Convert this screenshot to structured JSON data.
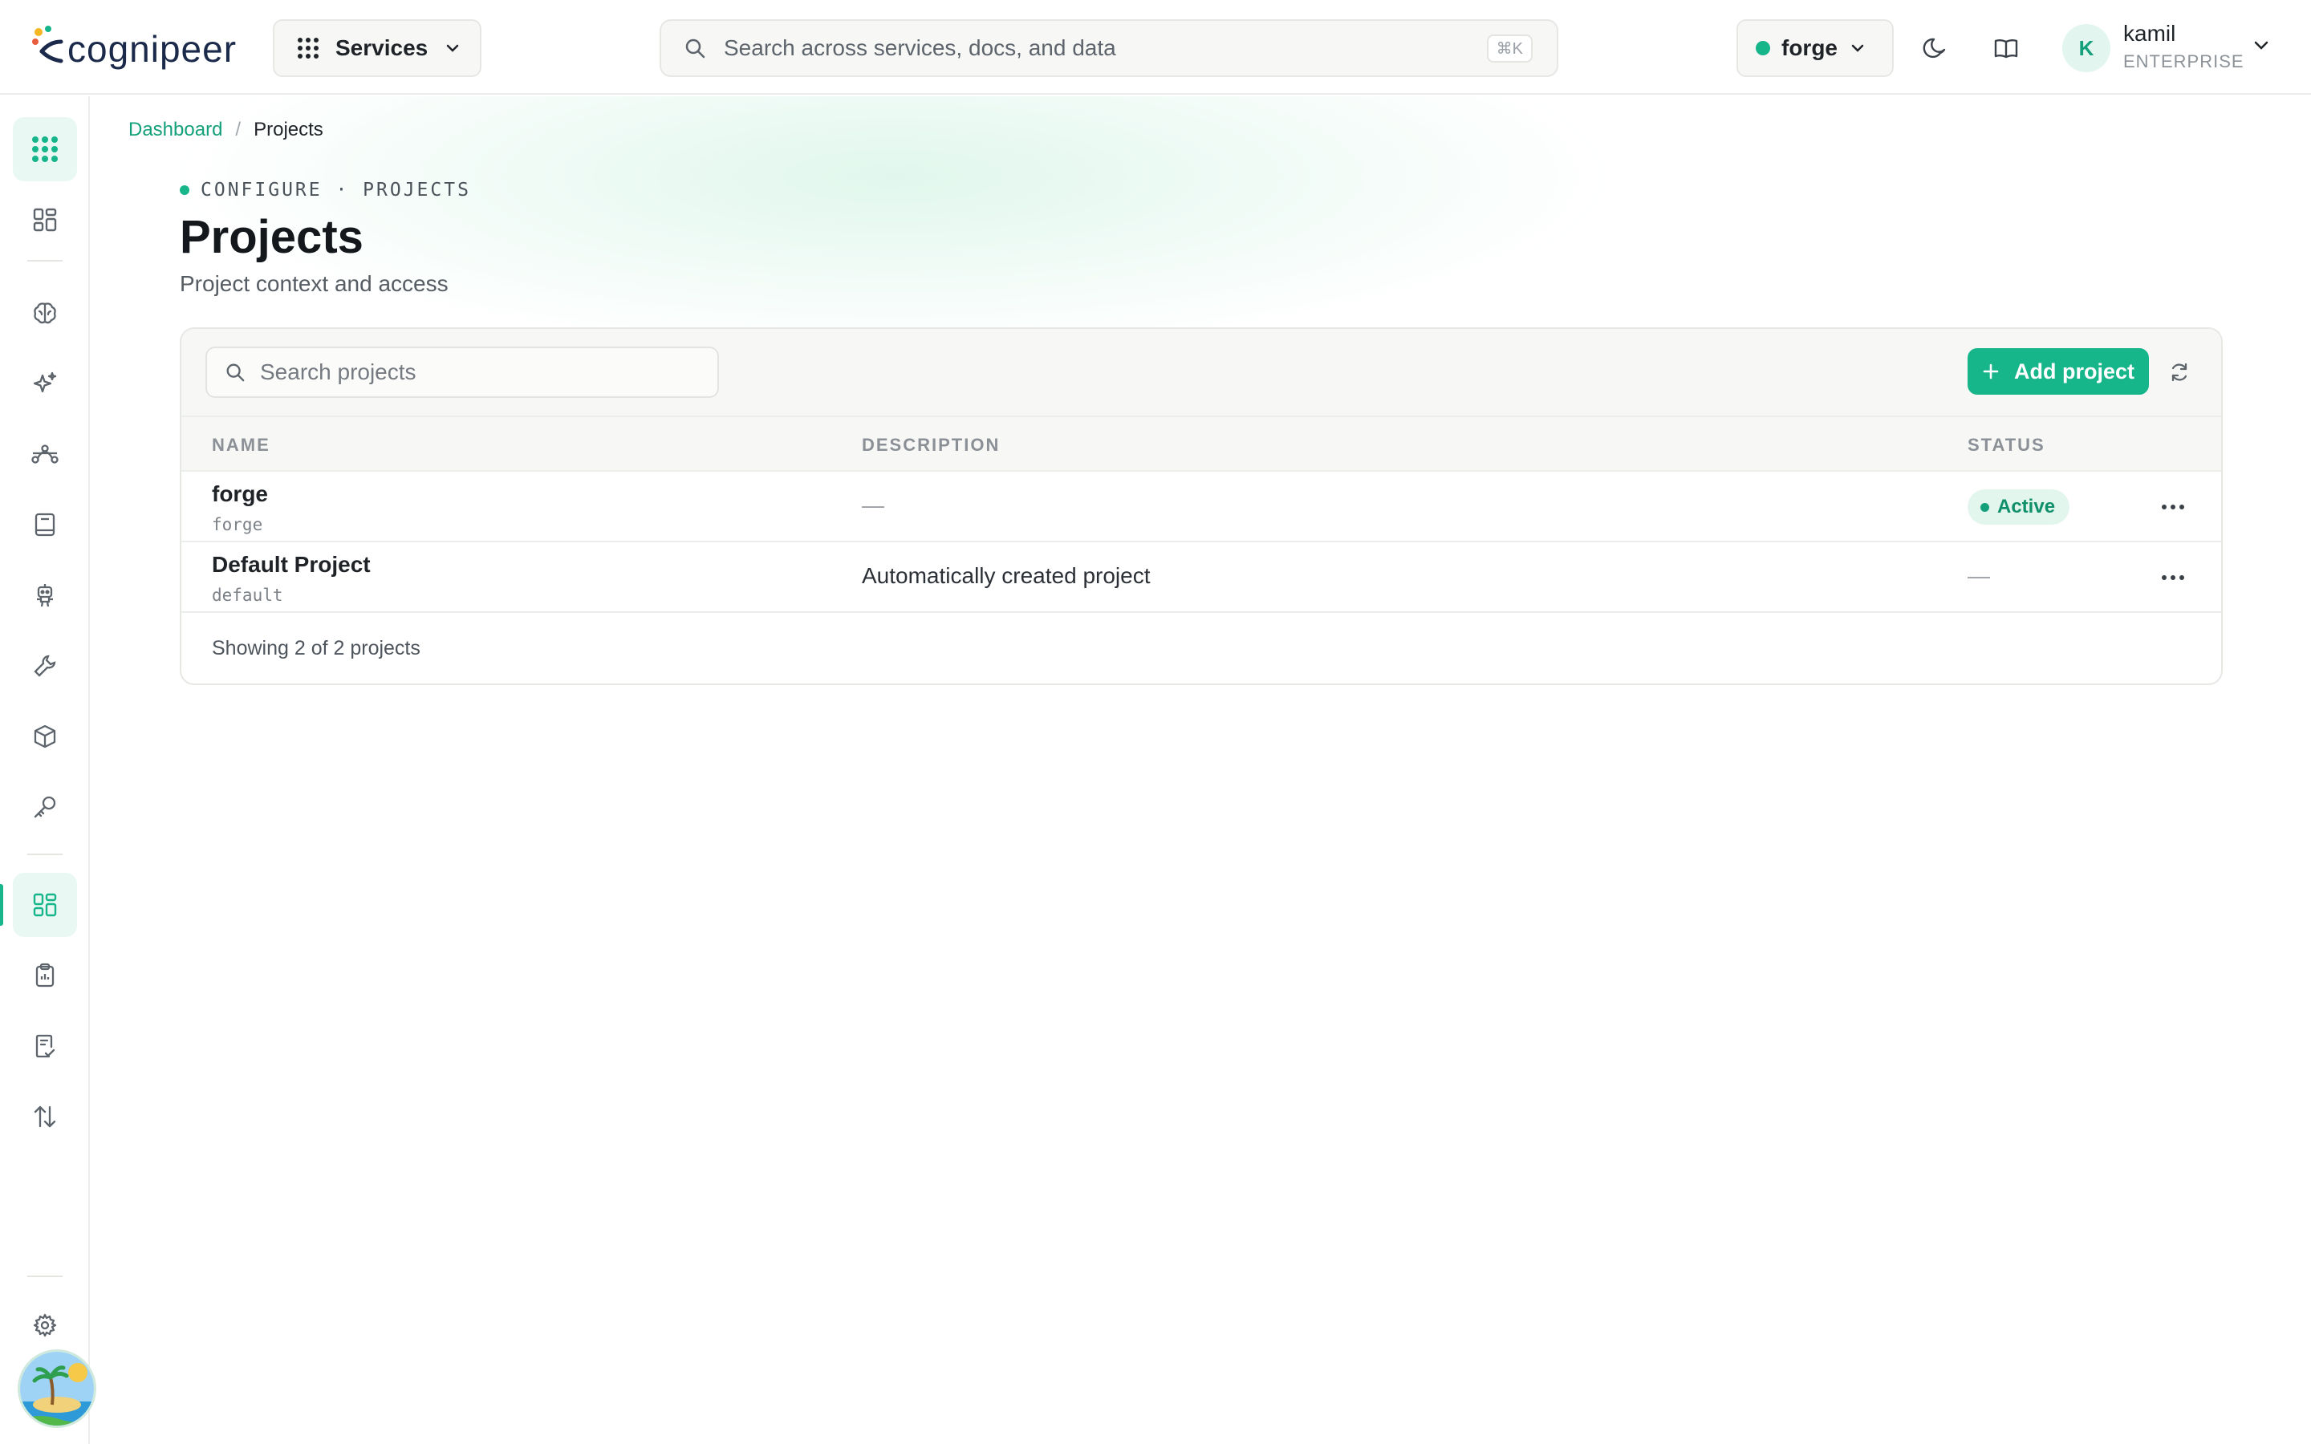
{
  "app": {
    "logo_text": "cognipeer",
    "services_label": "Services",
    "search_placeholder": "Search across services, docs, and data",
    "search_shortcut": "⌘K",
    "project_switcher": "forge",
    "user": {
      "initial": "K",
      "name": "kamil",
      "tier": "ENTERPRISE"
    }
  },
  "sidebar": {
    "icons": [
      "apps-grid-icon",
      "dashboard-icon",
      "brain-icon",
      "sparkles-icon",
      "flow-icon",
      "book-icon",
      "robot-icon",
      "tools-icon",
      "cube-icon",
      "key-icon",
      "projects-icon",
      "clipboard-icon",
      "checklist-icon",
      "transfer-icon",
      "gear-icon"
    ],
    "active": "projects-icon"
  },
  "breadcrumb": {
    "root": "Dashboard",
    "separator": "/",
    "current": "Projects"
  },
  "page": {
    "eyebrow": "CONFIGURE · PROJECTS",
    "title": "Projects",
    "subtitle": "Project context and access"
  },
  "table": {
    "search_placeholder": "Search projects",
    "add_label": "Add project",
    "columns": {
      "name": "NAME",
      "description": "DESCRIPTION",
      "status": "STATUS"
    },
    "rows": [
      {
        "name": "forge",
        "slug": "forge",
        "description": "—",
        "status": "Active"
      },
      {
        "name": "Default Project",
        "slug": "default",
        "description": "Automatically created project",
        "status": "—"
      }
    ],
    "footer": "Showing 2 of 2 projects"
  },
  "colors": {
    "accent": "#17b58a",
    "accent_dark": "#13a07a",
    "badge_bg": "#e3f6ee"
  }
}
